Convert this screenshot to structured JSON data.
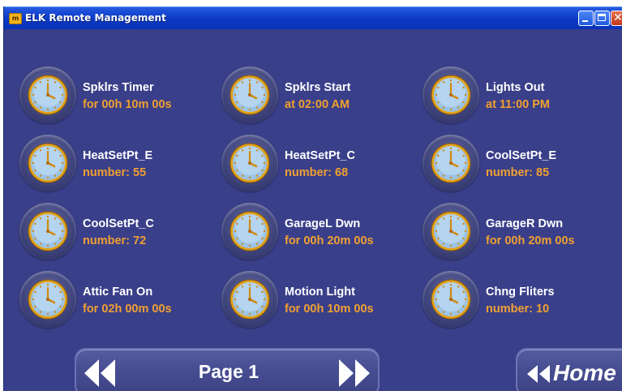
{
  "window": {
    "title": "ELK Remote Management",
    "app_icon": "elk-logo-icon"
  },
  "timers": [
    {
      "name": "Spklrs Timer",
      "value": "for  00h 10m 00s"
    },
    {
      "name": "Spklrs Start",
      "value": "at  02:00 AM"
    },
    {
      "name": "Lights Out",
      "value": "at  11:00 PM"
    },
    {
      "name": "HeatSetPt_E",
      "value": "number:  55"
    },
    {
      "name": "HeatSetPt_C",
      "value": "number:  68"
    },
    {
      "name": "CoolSetPt_E",
      "value": "number:  85"
    },
    {
      "name": "CoolSetPt_C",
      "value": "number:  72"
    },
    {
      "name": "GarageL Dwn",
      "value": "for  00h 20m 00s"
    },
    {
      "name": "GarageR Dwn",
      "value": "for  00h 20m 00s"
    },
    {
      "name": "Attic Fan On",
      "value": "for  02h 00m 00s"
    },
    {
      "name": "Motion Light",
      "value": "for  00h 10m 00s"
    },
    {
      "name": "Chng Fliters",
      "value": "number:  10"
    }
  ],
  "pager": {
    "label": "Page 1",
    "prev_icon": "double-chevron-left-icon",
    "next_icon": "double-chevron-right-icon"
  },
  "home": {
    "label": "Home",
    "icon": "double-chevron-left-icon"
  },
  "colors": {
    "background": "#3a3f8a",
    "value_text": "#f0a030",
    "title_bar": "#0b39c6"
  }
}
